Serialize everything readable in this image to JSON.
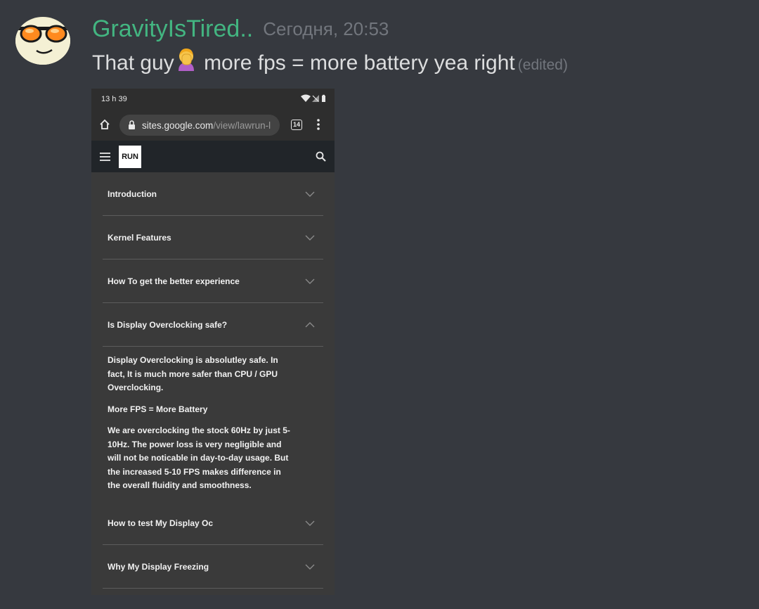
{
  "message": {
    "username": "GravityIsTired..",
    "timestamp": "Сегодня, 20:53",
    "text_before": "That guy",
    "text_after": " more fps = more battery yea right",
    "edited": "(edited)",
    "emoji": "woman-facepalming",
    "username_color": "#43b581"
  },
  "phone": {
    "status_time": "13 h 39",
    "url_host": "sites.google.com",
    "url_path": "/view/lawrun-l",
    "tab_count": "14",
    "logo_text": "RUN",
    "sections": [
      {
        "title": "Introduction",
        "expanded": false
      },
      {
        "title": "Kernel Features",
        "expanded": false
      },
      {
        "title": "How To get the better experience",
        "expanded": false
      },
      {
        "title": "Is Display Overclocking safe?",
        "expanded": true
      },
      {
        "title": "How to test My Display Oc",
        "expanded": false
      },
      {
        "title": "Why My Display Freezing",
        "expanded": false
      }
    ],
    "expanded_content": [
      "Display Overclocking is absolutley safe. In fact, It is much more safer than CPU / GPU Overclocking.",
      "More FPS = More Battery",
      "We are overclocking the stock 60Hz by just 5-10Hz. The power loss is very negligible and will not be noticable in day-to-day usage. But the increased 5-10 FPS makes difference in the overall fluidity and smoothness."
    ]
  }
}
